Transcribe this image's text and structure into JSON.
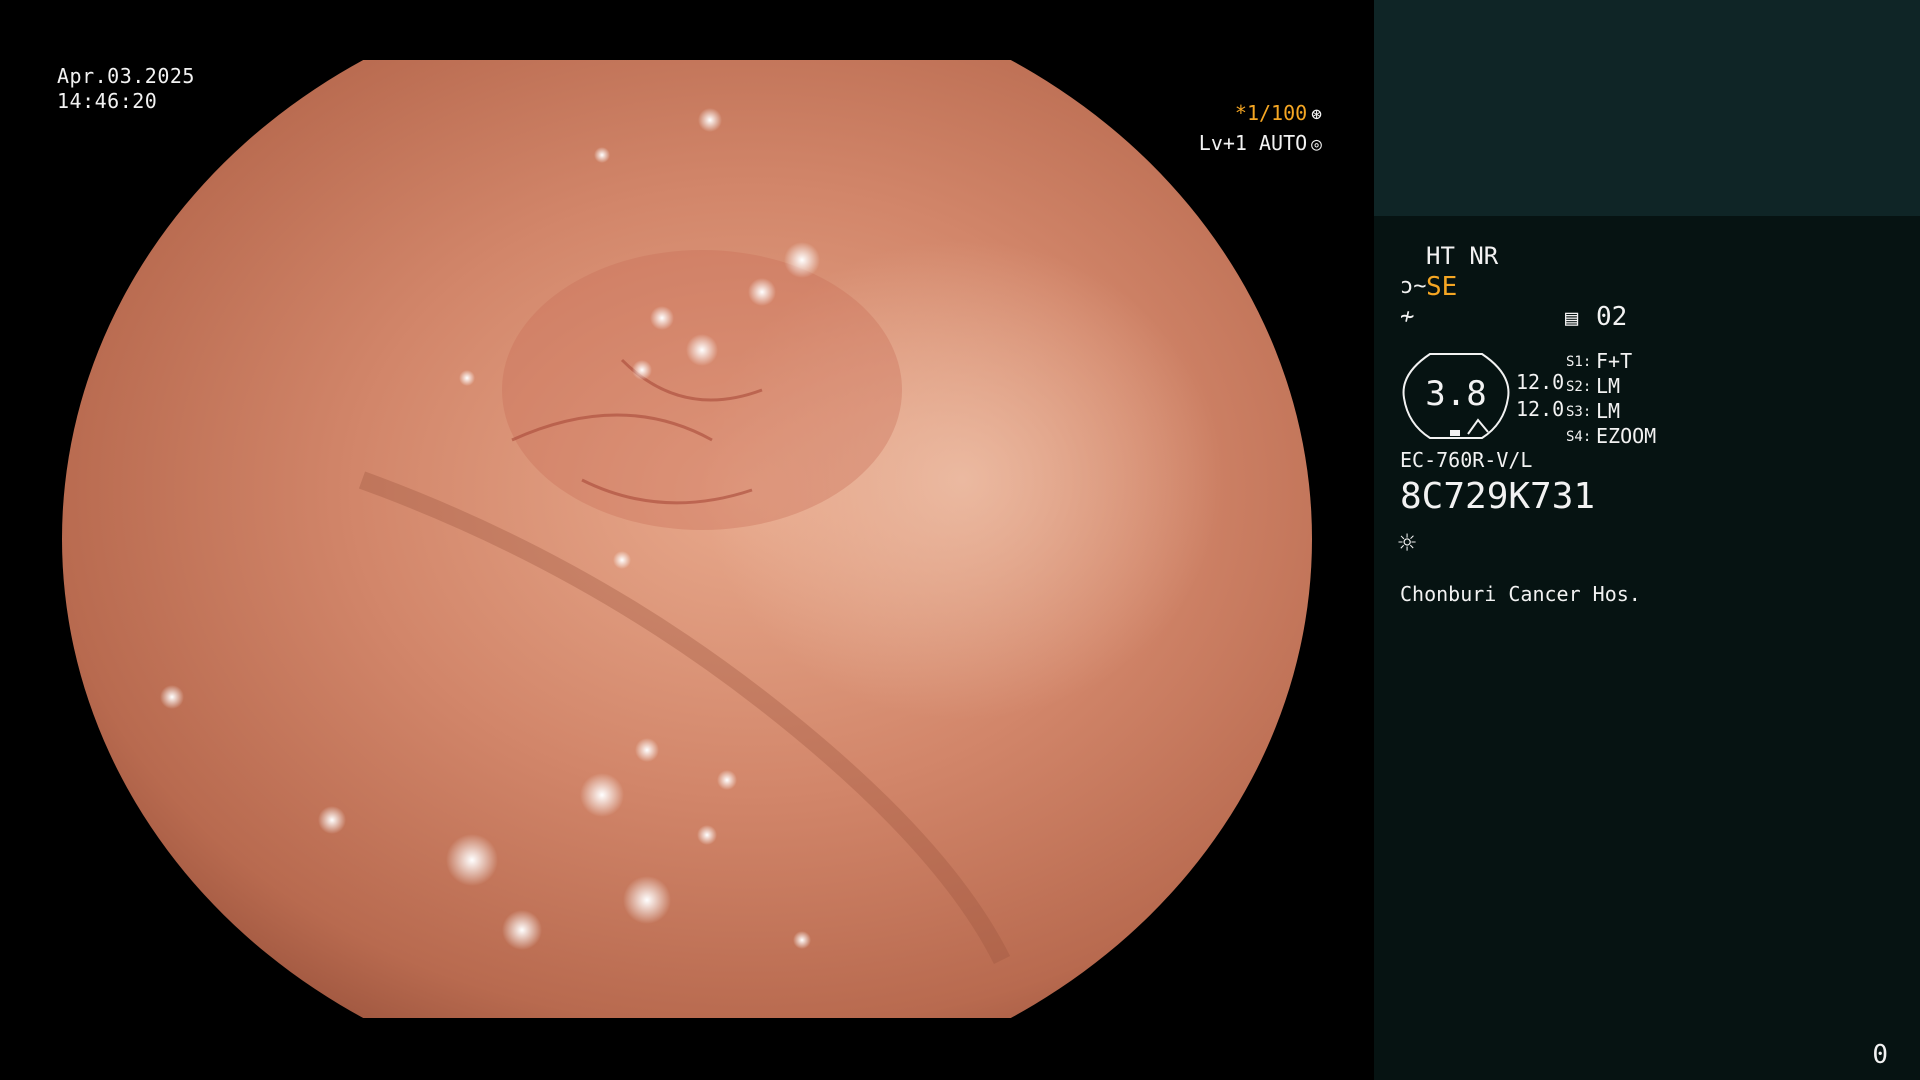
{
  "datetime": {
    "date": "Apr.03.2025",
    "time": "14:46:20"
  },
  "shutter": {
    "value": "*1/100",
    "icon": "shutter-icon"
  },
  "exposure": {
    "value": "Lv+1 AUTO",
    "icon": "iris-icon"
  },
  "panel": {
    "modes": "HT NR",
    "se_label": "SE",
    "se_icon": "structure-enhance-icon",
    "signal_icon": "color-signal-icon",
    "channel_icon": "document-icon",
    "channel": "02",
    "lens_value": "3.8",
    "focus_values": [
      "12.0",
      "12.0"
    ],
    "switches": [
      {
        "label": "S1:",
        "value": "F+T"
      },
      {
        "label": "S2:",
        "value": "LM"
      },
      {
        "label": "S3:",
        "value": "LM"
      },
      {
        "label": "S4:",
        "value": "EZOOM"
      }
    ],
    "model": "EC-760R-V/L",
    "serial": "8C729K731",
    "light_icon": "light-source-icon",
    "hospital": "Chonburi Cancer Hos."
  },
  "counter": "0",
  "colors": {
    "accent": "#f5a623",
    "panel_top": "#0f2526",
    "panel_bottom": "#061312"
  }
}
